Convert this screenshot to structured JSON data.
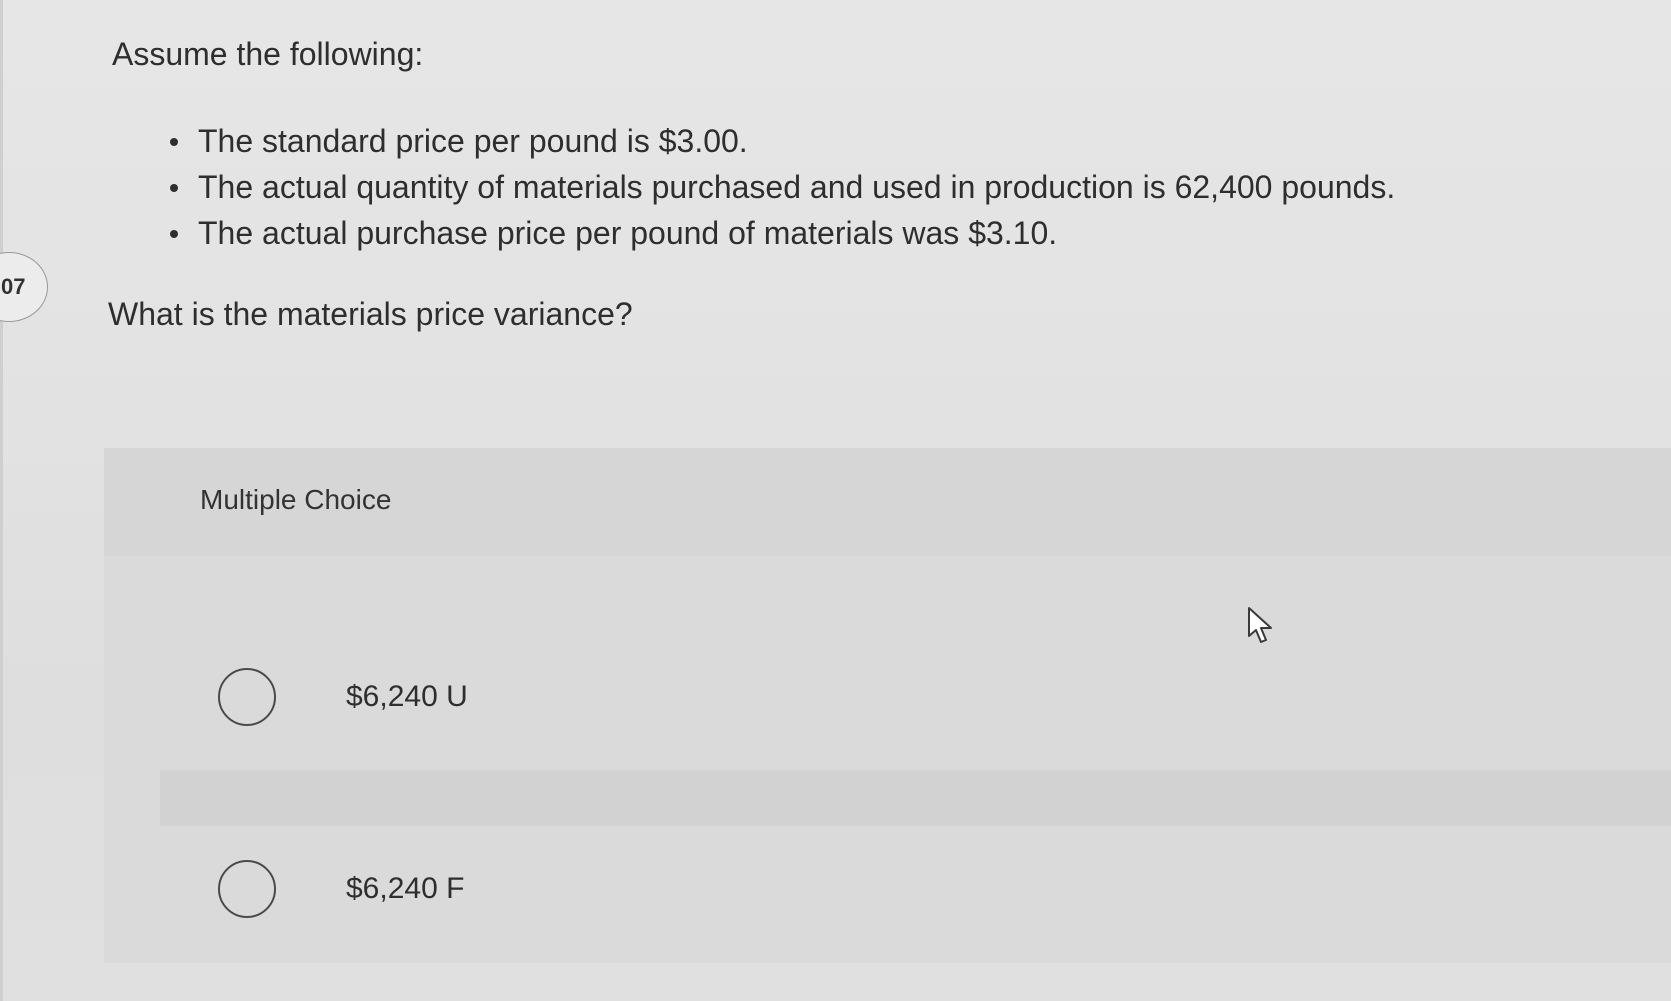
{
  "question_number": "07",
  "intro": "Assume the following:",
  "bullets": [
    "The standard price per pound is $3.00.",
    "The actual quantity of materials purchased and used in production is 62,400 pounds.",
    "The actual purchase price per pound of materials was $3.10."
  ],
  "question": "What is the materials price variance?",
  "multiple_choice": {
    "title": "Multiple Choice",
    "options": [
      {
        "label": "$6,240 U",
        "selected": false
      },
      {
        "label": "$6,240 F",
        "selected": false
      }
    ]
  },
  "icons": {
    "cursor": "mouse-pointer-icon"
  }
}
